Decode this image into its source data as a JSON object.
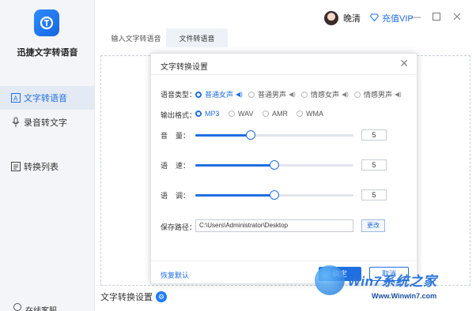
{
  "app": {
    "name": "迅捷文字转语音",
    "brand_color": "#1f6fe0"
  },
  "sidebar": {
    "items": [
      {
        "label": "文字转语音",
        "icon": "text-icon",
        "active": true
      },
      {
        "label": "录音转文字",
        "icon": "microphone-icon",
        "active": false
      },
      {
        "label": "转换列表",
        "icon": "list-icon",
        "active": false
      }
    ],
    "bottom_label": "在线客服"
  },
  "topbar": {
    "username": "晚清",
    "vip_label": "充值VIP"
  },
  "tabs": [
    {
      "label": "输入文字转语音",
      "active": false
    },
    {
      "label": "文件转语音",
      "active": true
    }
  ],
  "bottom": {
    "settings_label": "文字转换设置"
  },
  "dialog": {
    "title": "文字转换设置",
    "voice_type": {
      "label": "语音类型：",
      "options": [
        "普通女声",
        "普通男声",
        "情感女声",
        "情感男声"
      ],
      "selected": "普通女声"
    },
    "output_format": {
      "label": "输出格式：",
      "options": [
        "MP3",
        "WAV",
        "AMR",
        "WMA"
      ],
      "selected": "MP3"
    },
    "volume": {
      "label": "音    量：",
      "value": "5",
      "level": 0.35
    },
    "speed": {
      "label": "语    速：",
      "value": "5",
      "level": 0.5
    },
    "tone": {
      "label": "语    调：",
      "value": "5",
      "level": 0.5
    },
    "save_path": {
      "label": "保存路径：",
      "value": "C:\\Users\\Administrator\\Desktop",
      "change_label": "更改"
    },
    "restore_label": "恢复默认",
    "ok_label": "确定",
    "cancel_label": "取消"
  },
  "watermark": {
    "brand": "Win7系统之家",
    "url": "Www.Winwin7.com"
  }
}
